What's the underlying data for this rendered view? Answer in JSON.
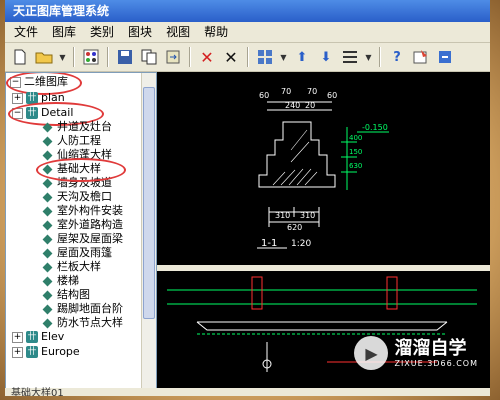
{
  "window": {
    "title": "天正图库管理系统"
  },
  "menu": [
    "文件",
    "图库",
    "类别",
    "图块",
    "视图",
    "帮助"
  ],
  "toolbar_icons": [
    "new-file-icon",
    "open-folder-icon",
    "dropdown-arrow-icon",
    "grid-icon",
    "save-icon",
    "copy-icon",
    "replace-icon",
    "delete-icon",
    "close-icon",
    "view-mode-icon",
    "dropdown-arrow-icon",
    "move-up-icon",
    "move-down-icon",
    "list-icon",
    "dropdown-arrow-icon",
    "help-icon",
    "settings-icon",
    "exit-icon"
  ],
  "tree": {
    "root": "二维图库",
    "plan": "plan",
    "detail": "Detail",
    "detail_items": [
      "井道及灶台",
      "人防工程",
      "仙缩蓬大样",
      "基础大样",
      "墙身及坡道",
      "天沟及檐口",
      "室外构件安装",
      "室外道路构造",
      "屋架及屋面梁",
      "屋面及雨篷",
      "栏板大样",
      "楼梯",
      "结构图",
      "踢脚地面台阶",
      "防水节点大样"
    ],
    "elev": "Elev",
    "europe": "Europe",
    "selected": "基础大样"
  },
  "drawing": {
    "dims_top": [
      "60",
      "70",
      "70",
      "60",
      "240",
      "20"
    ],
    "level_mark": "-0.150",
    "dims_side": [
      "400",
      "150",
      "630"
    ],
    "dims_bottom": [
      "310",
      "310",
      "620"
    ],
    "section_label": "1-1",
    "scale_label": "1:20"
  },
  "watermark": {
    "title": "溜溜自学",
    "url": "ZIXUE.3D66.COM"
  },
  "status": "基础大样01",
  "colors": {
    "canvas_bg": "#000000",
    "line_white": "#ffffff",
    "line_green": "#00ff66",
    "line_red": "#ff3030",
    "selection_outline": "#e03a3a"
  }
}
